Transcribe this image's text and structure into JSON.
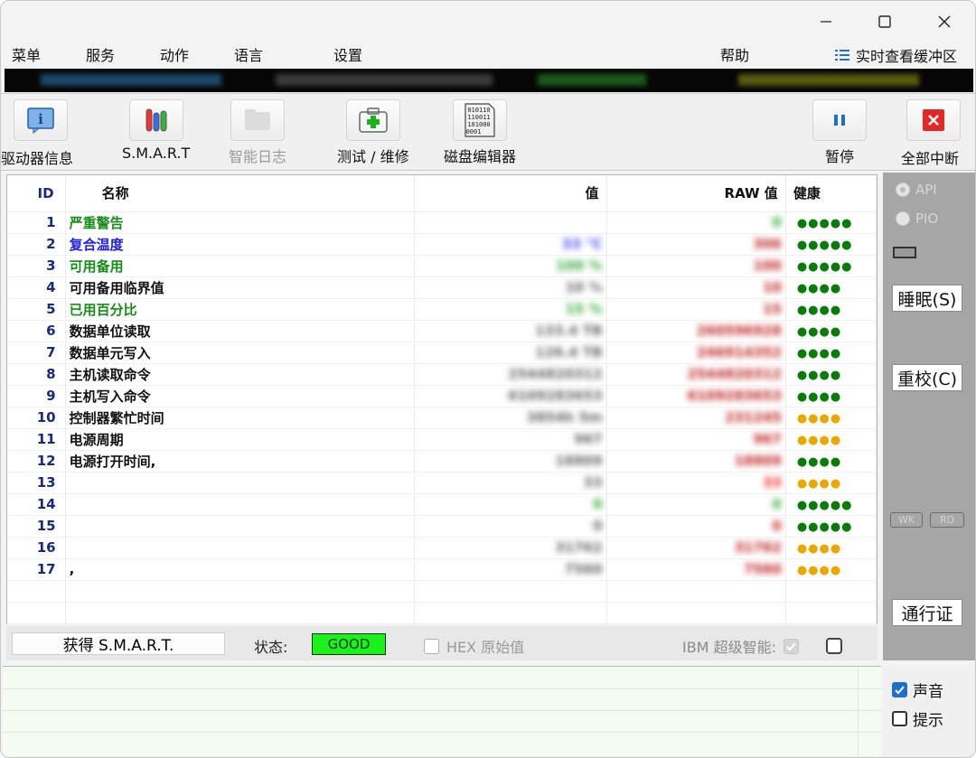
{
  "menu": {
    "items": [
      "菜单",
      "服务",
      "动作",
      "语言",
      "设置"
    ],
    "help": "帮助",
    "realtime": "实时查看缓冲区"
  },
  "toolbar": {
    "drive_info": "驱动器信息",
    "smart": "S.M.A.R.T",
    "smart_log": "智能日志",
    "test_repair": "测试 / 维修",
    "disk_editor": "磁盘编辑器",
    "pause": "暂停",
    "abort_all": "全部中断",
    "disk_editor_icon_text": "010110 110011 101000 0001"
  },
  "table": {
    "headers": {
      "id": "ID",
      "name": "名称",
      "value": "值",
      "raw": "RAW 值",
      "health": "健康"
    },
    "rows": [
      {
        "id": "1",
        "name": "严重警告",
        "name_color": "#1a8a1a",
        "value": "",
        "value_color": "#888888",
        "raw": "0",
        "raw_color": "#33aa33",
        "health": "●●●●●",
        "health_color": "#0a7a0a"
      },
      {
        "id": "2",
        "name": "复合温度",
        "name_color": "#2020e0",
        "value": "33 °C",
        "value_color": "#4a4aee",
        "raw": "306",
        "raw_color": "#c02020",
        "health": "●●●●●",
        "health_color": "#0a7a0a"
      },
      {
        "id": "3",
        "name": "可用备用",
        "name_color": "#1a8a1a",
        "value": "100 %",
        "value_color": "#33aa33",
        "raw": "100",
        "raw_color": "#c02020",
        "health": "●●●●●",
        "health_color": "#0a7a0a"
      },
      {
        "id": "4",
        "name": "可用备用临界值",
        "name_color": "#111111",
        "value": "10 %",
        "value_color": "#666666",
        "raw": "10",
        "raw_color": "#c02020",
        "health": "●●●●",
        "health_color": "#0a7a0a"
      },
      {
        "id": "5",
        "name": "已用百分比",
        "name_color": "#1a8a1a",
        "value": "15 %",
        "value_color": "#33aa33",
        "raw": "15",
        "raw_color": "#c02020",
        "health": "●●●●",
        "health_color": "#0a7a0a"
      },
      {
        "id": "6",
        "name": "数据单位读取",
        "name_color": "#111111",
        "value": "133.4 TB",
        "value_color": "#666666",
        "raw": "260596928",
        "raw_color": "#c02020",
        "health": "●●●●",
        "health_color": "#0a7a0a"
      },
      {
        "id": "7",
        "name": "数据单元写入",
        "name_color": "#111111",
        "value": "126.4 TB",
        "value_color": "#666666",
        "raw": "246914352",
        "raw_color": "#c02020",
        "health": "●●●●",
        "health_color": "#0a7a0a"
      },
      {
        "id": "8",
        "name": "主机读取命令",
        "name_color": "#111111",
        "value": "2544820312",
        "value_color": "#666666",
        "raw": "2544820312",
        "raw_color": "#c02020",
        "health": "●●●●",
        "health_color": "#0a7a0a"
      },
      {
        "id": "9",
        "name": "主机写入命令",
        "name_color": "#111111",
        "value": "6109283653",
        "value_color": "#666666",
        "raw": "6109283653",
        "raw_color": "#c02020",
        "health": "●●●●",
        "health_color": "#0a7a0a"
      },
      {
        "id": "10",
        "name": "控制器繁忙时间",
        "name_color": "#111111",
        "value": "3854h 5m",
        "value_color": "#666666",
        "raw": "231245",
        "raw_color": "#c02020",
        "health": "●●●●",
        "health_color": "#e8a800"
      },
      {
        "id": "11",
        "name": "电源周期",
        "name_color": "#111111",
        "value": "967",
        "value_color": "#666666",
        "raw": "967",
        "raw_color": "#c02020",
        "health": "●●●●",
        "health_color": "#e8a800"
      },
      {
        "id": "12",
        "name": "电源打开时间,",
        "name_color": "#111111",
        "value": "18809",
        "value_color": "#666666",
        "raw": "18809",
        "raw_color": "#c02020",
        "health": "●●●●",
        "health_color": "#0a7a0a"
      },
      {
        "id": "13",
        "name": "",
        "name_color": "#111111",
        "value": "33",
        "value_color": "#666666",
        "raw": "33",
        "raw_color": "#ee2020",
        "health": "●●●●",
        "health_color": "#e8a800"
      },
      {
        "id": "14",
        "name": "",
        "name_color": "#111111",
        "value": "0",
        "value_color": "#33aa33",
        "raw": "0",
        "raw_color": "#33aa33",
        "health": "●●●●●",
        "health_color": "#0a7a0a"
      },
      {
        "id": "15",
        "name": "",
        "name_color": "#111111",
        "value": "0",
        "value_color": "#666666",
        "raw": "0",
        "raw_color": "#c02020",
        "health": "●●●●●",
        "health_color": "#0a7a0a"
      },
      {
        "id": "16",
        "name": "",
        "name_color": "#111111",
        "value": "31762",
        "value_color": "#666666",
        "raw": "31762",
        "raw_color": "#c02020",
        "health": "●●●●",
        "health_color": "#e8a800"
      },
      {
        "id": "17",
        "name": ",",
        "name_color": "#111111",
        "value": "7560",
        "value_color": "#666666",
        "raw": "7560",
        "raw_color": "#c02020",
        "health": "●●●●",
        "health_color": "#e8a800"
      }
    ]
  },
  "smart_bar": {
    "get_smart": "获得 S.M.A.R.T.",
    "state_label": "状态:",
    "state_value": "GOOD",
    "hex_label": "HEX 原始值",
    "ibm_label": "IBM 超级智能:"
  },
  "right_panel": {
    "api": "API",
    "pio": "PIO",
    "sleep": "睡眠(S)",
    "recal": "重校(C)",
    "wk": "WK",
    "rd": "RD",
    "pass": "通行证"
  },
  "bottom_right": {
    "sound": "声音",
    "hint": "提示"
  },
  "colors": {
    "good_badge": "#1df11d",
    "check_blue": "#1f6fc8",
    "panel_gray": "#a6a6a6"
  }
}
